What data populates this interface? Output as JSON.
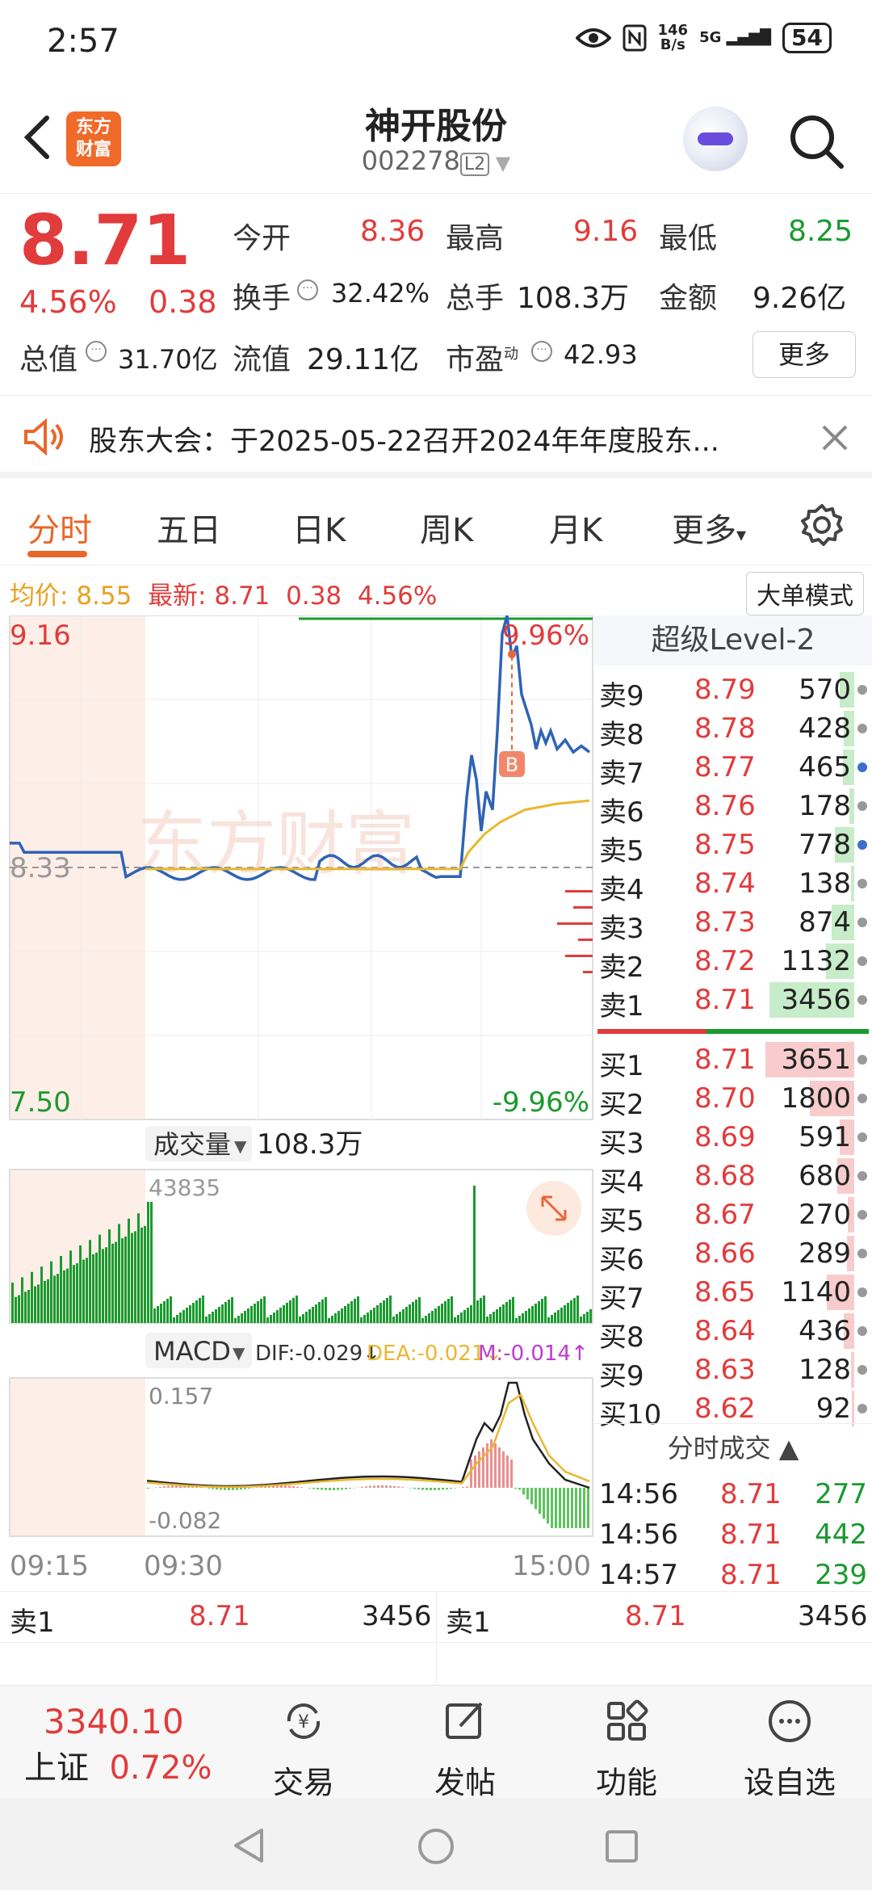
{
  "status": {
    "time": "2:57",
    "net_top": "146",
    "net_bottom": "B/s",
    "signal": "5G",
    "battery": "54"
  },
  "header": {
    "logo_line1": "东方",
    "logo_line2": "财富",
    "title": "神开股份",
    "code": "002278",
    "level": "L2"
  },
  "quote": {
    "price": "8.71",
    "pct": "4.56%",
    "change": "0.38",
    "open_label": "今开",
    "open": "8.36",
    "high_label": "最高",
    "high": "9.16",
    "low_label": "最低",
    "low": "8.25",
    "turnover_label": "换手",
    "turnover": "32.42%",
    "volume_label": "总手",
    "volume": "108.3万",
    "amount_label": "金额",
    "amount": "9.26亿",
    "mcap_label": "总值",
    "mcap": "31.70亿",
    "float_label": "流值",
    "float": "29.11亿",
    "pe_label": "市盈",
    "pe_sup": "动",
    "pe": "42.93",
    "more": "更多"
  },
  "notice": {
    "text": "股东大会：于2025-05-22召开2024年年度股东..."
  },
  "tabs": [
    "分时",
    "五日",
    "日K",
    "周K",
    "月K",
    "更多"
  ],
  "chart": {
    "avg_label": "均价:",
    "avg": "8.55",
    "latest_label": "最新:",
    "latest": "8.71",
    "latest_chg": "0.38",
    "latest_pct": "4.56%",
    "big_mode": "大单模式",
    "y_top": "9.16",
    "y_mid": "8.33",
    "y_bottom": "7.50",
    "pct_top": "9.96%",
    "pct_bottom": "-9.96%",
    "marker": "B",
    "vol_label": "成交量",
    "vol_total": "108.3万",
    "vol_max": "43835",
    "macd_label": "MACD",
    "dif": "DIF:-0.029↓",
    "dea": "DEA:-0.021↓",
    "m": "M:-0.014↑",
    "macd_top": "0.157",
    "macd_bottom": "-0.082",
    "t_start": "09:15",
    "t_open": "09:30",
    "t_end": "15:00",
    "watermark": "东方财富"
  },
  "level2": {
    "title": "超级Level-2",
    "asks": [
      {
        "label": "卖9",
        "price": "8.79",
        "vol": "570",
        "bar": 0.16,
        "dot": "gray"
      },
      {
        "label": "卖8",
        "price": "8.78",
        "vol": "428",
        "bar": 0.12,
        "dot": "gray"
      },
      {
        "label": "卖7",
        "price": "8.77",
        "vol": "465",
        "bar": 0.13,
        "dot": "blue"
      },
      {
        "label": "卖6",
        "price": "8.76",
        "vol": "178",
        "bar": 0.05,
        "dot": "gray"
      },
      {
        "label": "卖5",
        "price": "8.75",
        "vol": "778",
        "bar": 0.22,
        "dot": "blue"
      },
      {
        "label": "卖4",
        "price": "8.74",
        "vol": "138",
        "bar": 0.04,
        "dot": "gray"
      },
      {
        "label": "卖3",
        "price": "8.73",
        "vol": "874",
        "bar": 0.25,
        "dot": "gray"
      },
      {
        "label": "卖2",
        "price": "8.72",
        "vol": "1132",
        "bar": 0.32,
        "dot": "gray"
      },
      {
        "label": "卖1",
        "price": "8.71",
        "vol": "3456",
        "bar": 0.95,
        "dot": "gray"
      }
    ],
    "bids": [
      {
        "label": "买1",
        "price": "8.71",
        "vol": "3651",
        "bar": 1.0,
        "dot": "gray"
      },
      {
        "label": "买2",
        "price": "8.70",
        "vol": "1800",
        "bar": 0.5,
        "dot": "gray"
      },
      {
        "label": "买3",
        "price": "8.69",
        "vol": "591",
        "bar": 0.16,
        "dot": "gray"
      },
      {
        "label": "买4",
        "price": "8.68",
        "vol": "680",
        "bar": 0.19,
        "dot": "gray"
      },
      {
        "label": "买5",
        "price": "8.67",
        "vol": "270",
        "bar": 0.07,
        "dot": "gray"
      },
      {
        "label": "买6",
        "price": "8.66",
        "vol": "289",
        "bar": 0.08,
        "dot": "gray"
      },
      {
        "label": "买7",
        "price": "8.65",
        "vol": "1140",
        "bar": 0.31,
        "dot": "gray"
      },
      {
        "label": "买8",
        "price": "8.64",
        "vol": "436",
        "bar": 0.12,
        "dot": "gray"
      },
      {
        "label": "买9",
        "price": "8.63",
        "vol": "128",
        "bar": 0.04,
        "dot": "gray"
      },
      {
        "label": "买10",
        "price": "8.62",
        "vol": "92",
        "bar": 0.03,
        "dot": "gray"
      }
    ],
    "trades_title": "分时成交",
    "trades": [
      {
        "time": "14:56",
        "price": "8.71",
        "vol": "277"
      },
      {
        "time": "14:56",
        "price": "8.71",
        "vol": "442"
      },
      {
        "time": "14:57",
        "price": "8.71",
        "vol": "239"
      }
    ]
  },
  "bottom_quote": {
    "left_label": "卖1",
    "left_price": "8.71",
    "left_vol": "3456",
    "right_label": "卖1",
    "right_price": "8.71",
    "right_vol": "3456"
  },
  "bottom_nav": {
    "index_value": "3340.10",
    "index_name": "上证",
    "index_pct": "0.72%",
    "items": [
      "交易",
      "发帖",
      "功能",
      "设自选"
    ]
  },
  "colors": {
    "up": "#e23b3b",
    "down": "#1a9a2e",
    "accent": "#e8672a",
    "price_line": "#2f63b7",
    "avg_line": "#e8b830"
  }
}
